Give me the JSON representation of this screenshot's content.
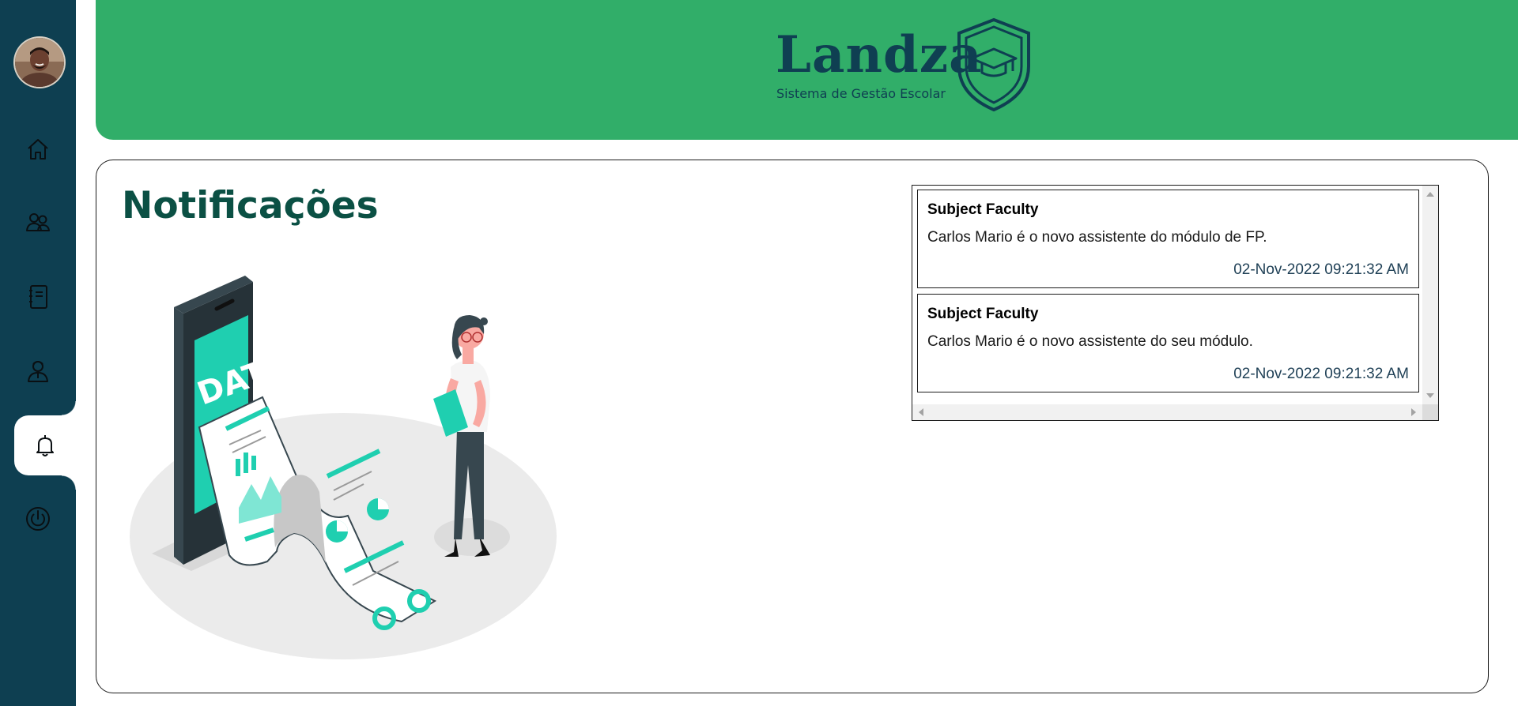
{
  "brand": {
    "name": "Landza",
    "tagline": "Sistema de Gestão Escolar"
  },
  "sidebar": {
    "items": [
      {
        "icon": "home-icon",
        "active": false
      },
      {
        "icon": "users-icon",
        "active": false
      },
      {
        "icon": "notebook-icon",
        "active": false
      },
      {
        "icon": "profile-icon",
        "active": false
      },
      {
        "icon": "bell-icon",
        "active": true
      },
      {
        "icon": "power-icon",
        "active": false
      }
    ]
  },
  "page": {
    "title": "Notificações",
    "illustration_text": "DATA"
  },
  "notifications": [
    {
      "subject": "Subject Faculty",
      "message": "Carlos Mario é o novo assistente do módulo de FP.",
      "date": "02-Nov-2022 09:21:32 AM"
    },
    {
      "subject": "Subject Faculty",
      "message": "Carlos Mario é o novo assistente do seu módulo.",
      "date": "02-Nov-2022 09:21:32 AM"
    }
  ],
  "colors": {
    "sidebar": "#0e3f51",
    "header": "#31ae69",
    "title": "#0b5044",
    "accent": "#1fcfb0"
  }
}
